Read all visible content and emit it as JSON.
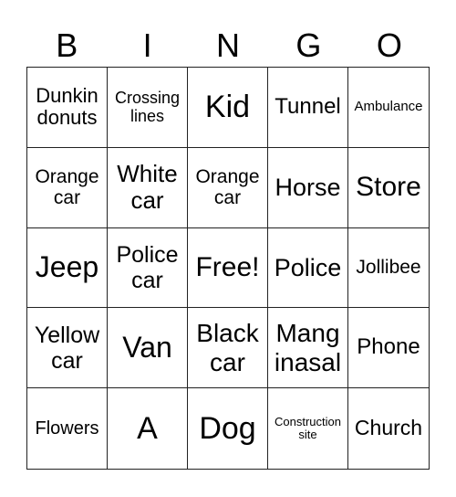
{
  "header": [
    "B",
    "I",
    "N",
    "G",
    "O"
  ],
  "cells": [
    "Dunkin donuts",
    "Crossing lines",
    "Kid",
    "Tunnel",
    "Ambulance",
    "Orange car",
    "White car",
    "Orange car",
    "Horse",
    "Store",
    "Jeep",
    "Police car",
    "Free!",
    "Police",
    "Jollibee",
    "Yellow car",
    "Van",
    "Black car",
    "Mang inasal",
    "Phone",
    "Flowers",
    "A",
    "Dog",
    "Construction site",
    "Church"
  ]
}
